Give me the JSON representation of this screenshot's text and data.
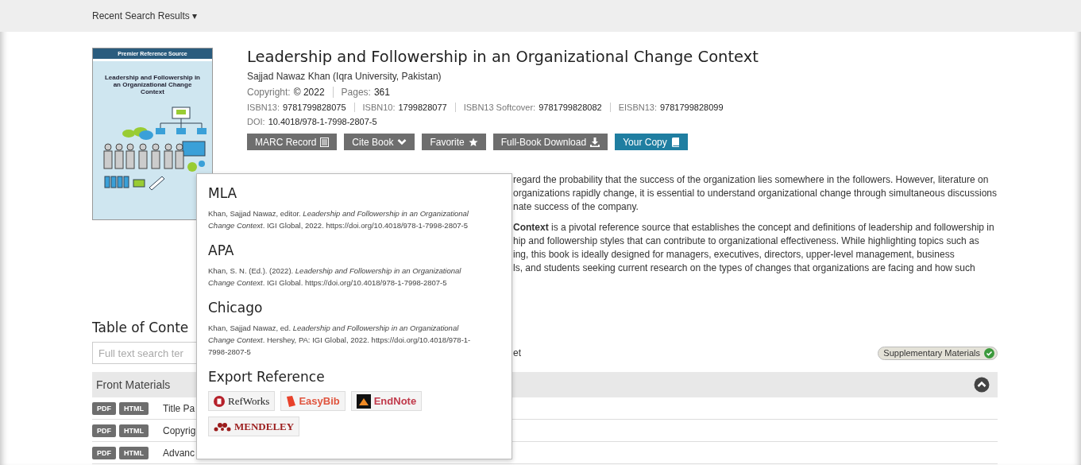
{
  "top_bar": {
    "label": "Recent Search Results",
    "caret": "▾"
  },
  "book": {
    "cover": {
      "series": "Premier Reference Source",
      "title": "Leadership and Followership in an Organizational Change Context"
    },
    "title": "Leadership and Followership in an Organizational Change Context",
    "author": "Sajjad Nawaz Khan (Iqra University, Pakistan)",
    "meta_rows": [
      [
        {
          "label": "Copyright:",
          "value": "© 2022"
        },
        {
          "label": "Pages:",
          "value": "361"
        }
      ],
      [
        {
          "label": "ISBN13:",
          "value": "9781799828075"
        },
        {
          "label": "ISBN10:",
          "value": "1799828077"
        },
        {
          "label": "ISBN13 Softcover:",
          "value": "9781799828082"
        },
        {
          "label": "EISBN13:",
          "value": "9781799828099"
        }
      ],
      [
        {
          "label": "DOI:",
          "value": "10.4018/978-1-7998-2807-5"
        }
      ]
    ],
    "buttons": [
      {
        "label": "MARC Record",
        "kind": "default"
      },
      {
        "label": "Cite Book",
        "kind": "default"
      },
      {
        "label": "Favorite",
        "kind": "default"
      },
      {
        "label": "Full-Book Download",
        "kind": "default"
      },
      {
        "label": "Your Copy",
        "kind": "highlight"
      }
    ],
    "description": [
      [
        "regard the probability that the success of the organization lies somewhere in the followers. However, literature on",
        "organizations rapidly change, it is essential to understand organizational change through simultaneous discussions",
        "nate success of the company."
      ],
      [
        "**Context** is a pivotal reference source that establishes the concept and definitions of leadership and followership in",
        "hip and followership styles that can contribute to organizational effectiveness. While highlighting topics such as",
        "ing, this book is ideally designed for managers, executives, directors, upper-level management, business",
        "ls, and students seeking current research on the types of changes that organizations are facing and how such"
      ]
    ]
  },
  "toc": {
    "heading": "Table of Conte",
    "search": {
      "placeholder": "Full text search ter"
    },
    "search_tail": "et",
    "supplementary": {
      "label": "Supplementary Materials",
      "available": true
    },
    "section": {
      "title": "Front Materials",
      "expanded": true
    },
    "rows": [
      {
        "formats": [
          "PDF",
          "HTML"
        ],
        "title": "Title Pa"
      },
      {
        "formats": [
          "PDF",
          "HTML"
        ],
        "title": "Copyrig"
      },
      {
        "formats": [
          "PDF",
          "HTML"
        ],
        "title": "Advanc"
      }
    ]
  },
  "cite_popup": {
    "styles": [
      {
        "name": "MLA",
        "citation": "Khan, Sajjad Nawaz, editor. *Leadership and Followership in an Organizational Change Context*. IGI Global, 2022. https://doi.org/10.4018/978-1-7998-2807-5"
      },
      {
        "name": "APA",
        "citation": "Khan, S. N. (Ed.). (2022). *Leadership and Followership in an Organizational Change Context*. IGI Global. https://doi.org/10.4018/978-1-7998-2807-5"
      },
      {
        "name": "Chicago",
        "citation": "Khan, Sajjad Nawaz, ed. *Leadership and Followership in an Organizational Change Context*. Hershey, PA: IGI Global, 2022. https://doi.org/10.4018/978-1-7998-2807-5"
      }
    ],
    "export_heading": "Export Reference",
    "exports": [
      {
        "label": "RefWorks",
        "kind": "refworks"
      },
      {
        "label": "EasyBib",
        "kind": "easybib"
      },
      {
        "label": "EndNote",
        "kind": "endnote"
      },
      {
        "label": "MENDELEY",
        "kind": "mendeley"
      }
    ]
  }
}
